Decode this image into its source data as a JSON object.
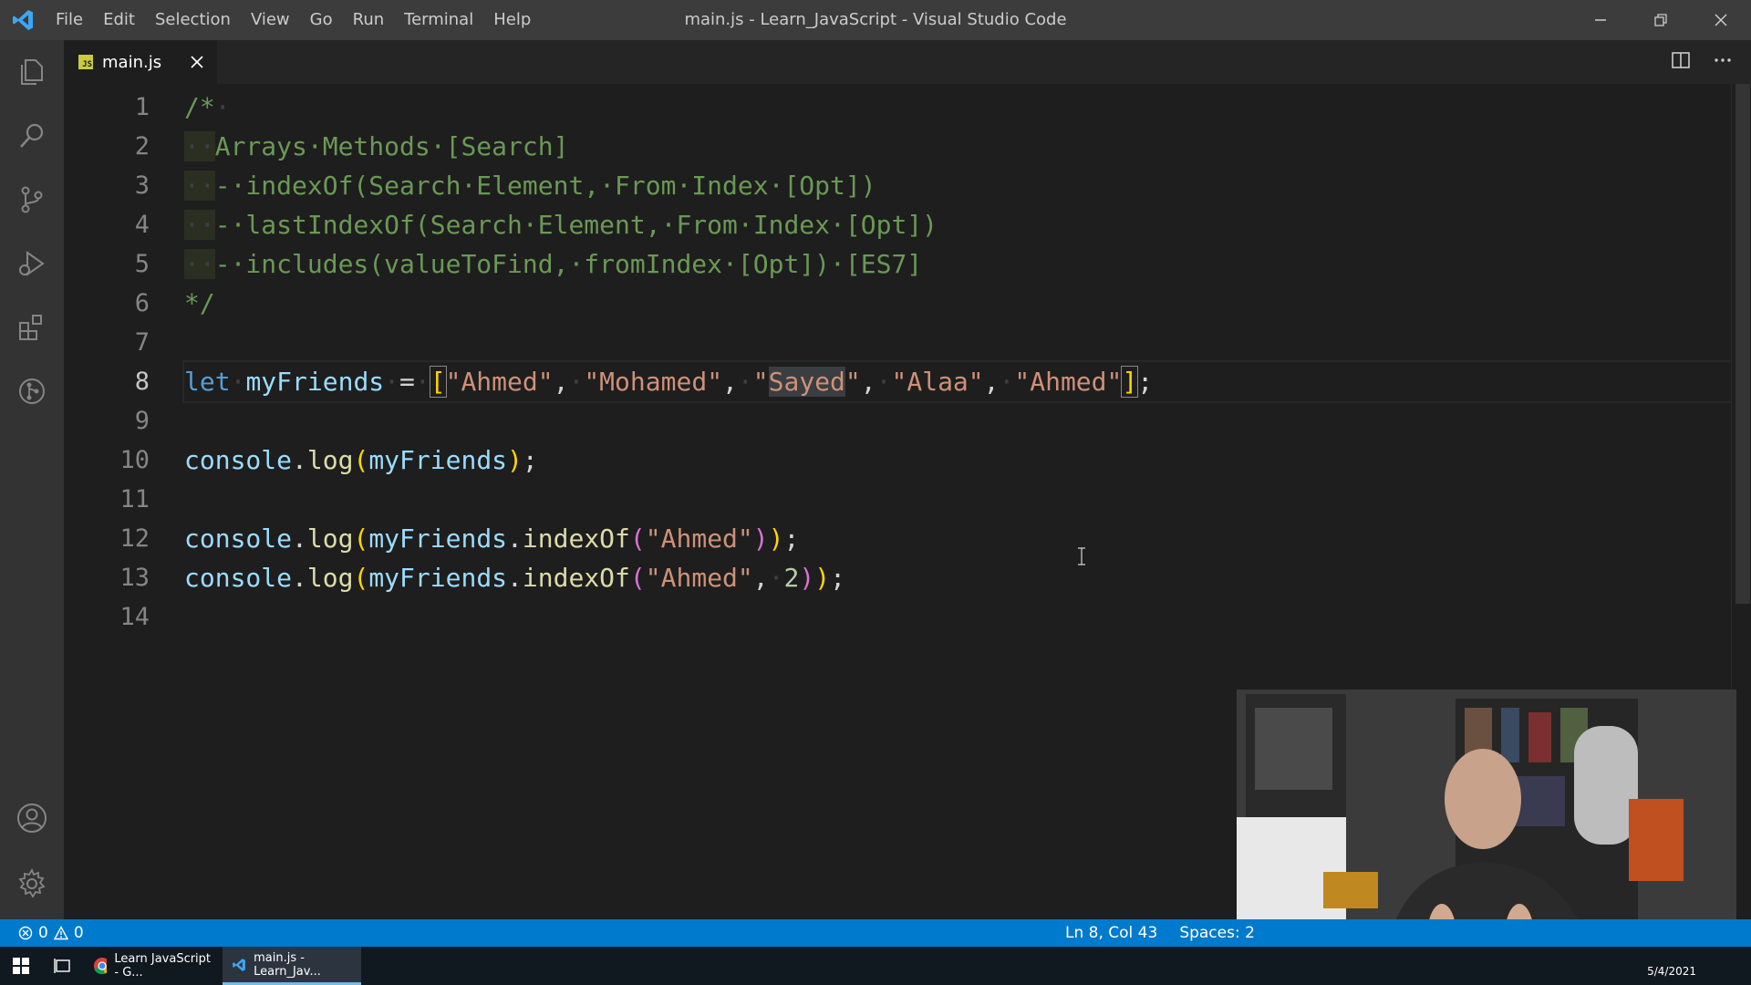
{
  "window": {
    "title": "main.js - Learn_JavaScript - Visual Studio Code",
    "menu": [
      "File",
      "Edit",
      "Selection",
      "View",
      "Go",
      "Run",
      "Terminal",
      "Help"
    ]
  },
  "activity_bar": {
    "top_icons": [
      "explorer-icon",
      "search-icon",
      "source-control-icon",
      "run-debug-icon",
      "extensions-icon",
      "git-graph-icon"
    ],
    "bottom_icons": [
      "account-icon",
      "settings-gear-icon"
    ]
  },
  "tabs": [
    {
      "label": "main.js",
      "icon": "js-file-icon",
      "active": true
    }
  ],
  "editor": {
    "line_numbers": [
      "1",
      "2",
      "3",
      "4",
      "5",
      "6",
      "7",
      "8",
      "9",
      "10",
      "11",
      "12",
      "13",
      "14"
    ],
    "current_line": 8,
    "lines": {
      "l1": "/*",
      "l2": "Arrays Methods [Search]",
      "l3": "- indexOf(Search Element, From Index [Opt])",
      "l4": "- lastIndexOf(Search Element, From Index [Opt])",
      "l5": "- includes(valueToFind, fromIndex [Opt]) [ES7]",
      "l6": "*/",
      "l8": {
        "kw": "let",
        "var": "myFriends",
        "op": "=",
        "items": [
          "\"Ahmed\"",
          "\"Mohamed\"",
          "\"",
          "Sayed",
          "\"",
          "\"Alaa\"",
          "\"Ahmed\""
        ]
      },
      "l10": {
        "obj": "console",
        "fn": "log",
        "arg": "myFriends"
      },
      "l12": {
        "obj": "console",
        "fn": "log",
        "arg": "myFriends",
        "method": "indexOf",
        "str": "\"Ahmed\""
      },
      "l13": {
        "obj": "console",
        "fn": "log",
        "arg": "myFriends",
        "method": "indexOf",
        "str": "\"Ahmed\"",
        "num": "2"
      }
    }
  },
  "status_bar": {
    "errors": "0",
    "warnings": "0",
    "position": "Ln 8, Col 43",
    "spaces": "Spaces: 2",
    "color": "#007acc"
  },
  "taskbar": {
    "apps": [
      {
        "label": "Learn JavaScript - G...",
        "icon": "chrome-icon"
      },
      {
        "label": "main.js - Learn_Jav...",
        "icon": "vscode-icon"
      }
    ],
    "date": "5/4/2021"
  },
  "colors": {
    "comment": "#6a9955",
    "keyword": "#569cd6",
    "variable": "#9cdcfe",
    "string": "#ce9178",
    "function": "#dcdcaa",
    "number": "#b5cea8"
  }
}
